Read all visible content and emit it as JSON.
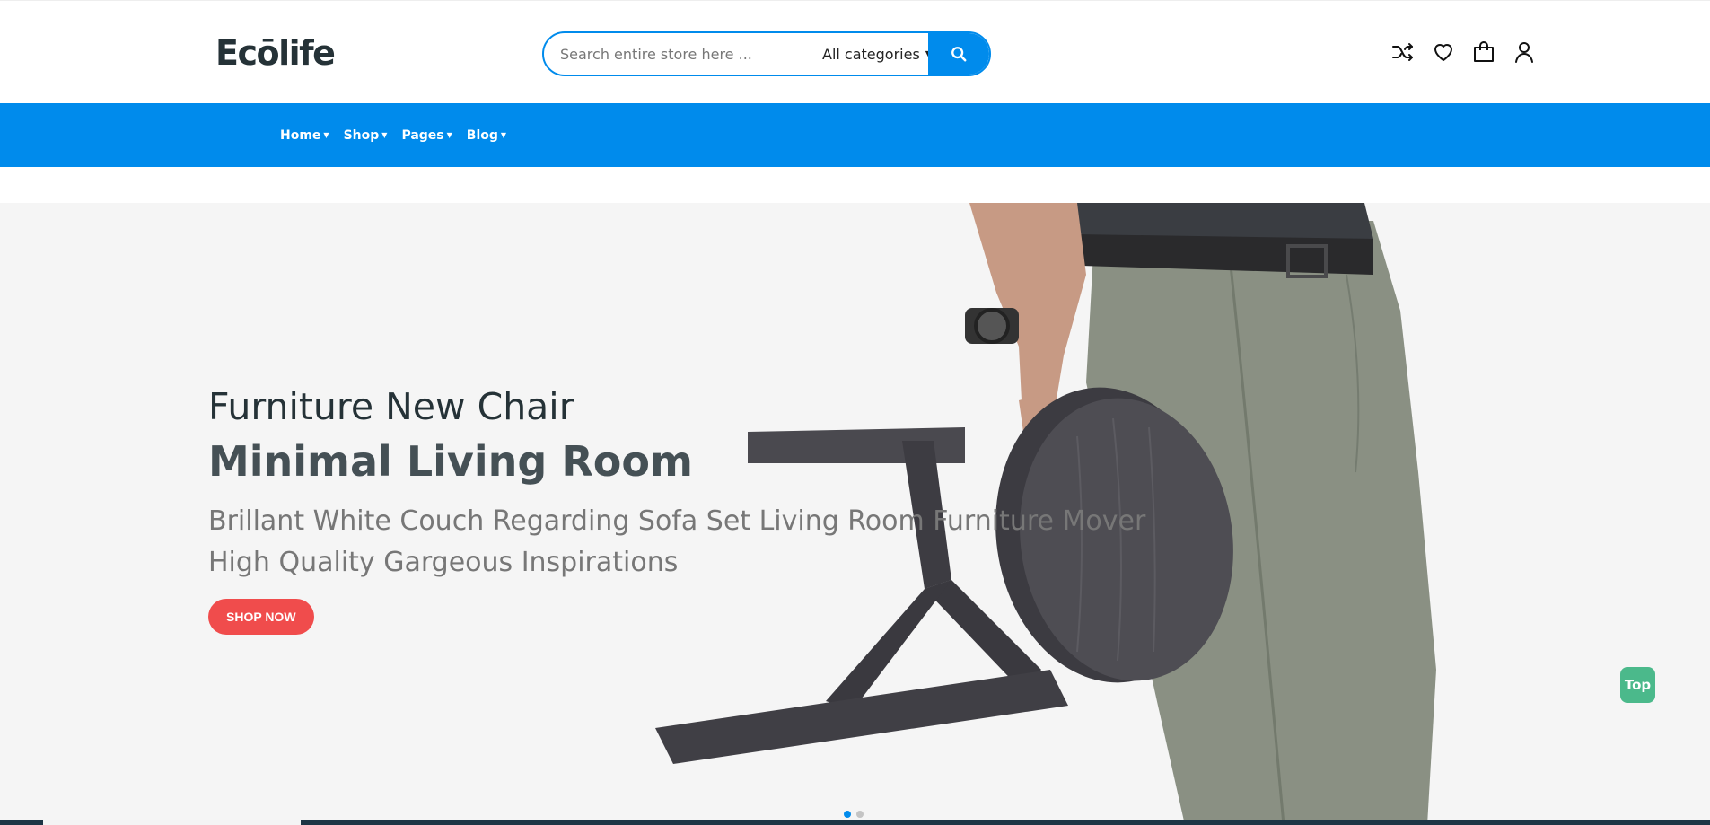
{
  "brand": {
    "logo_text": "Ecōlife"
  },
  "search": {
    "placeholder": "Search entire store here ...",
    "category": "All categories",
    "icon": "search-icon"
  },
  "header_icons": [
    "shuffle-icon",
    "heart-icon",
    "bag-icon",
    "user-icon"
  ],
  "nav": {
    "items": [
      {
        "label": "Home"
      },
      {
        "label": "Shop"
      },
      {
        "label": "Pages"
      },
      {
        "label": "Blog"
      }
    ]
  },
  "hero": {
    "subtitle": "Furniture New Chair",
    "title": "Minimal Living Room",
    "description": "Brillant White Couch Regarding Sofa Set Living Room Furniture Mover High Quality Gargeous Inspirations",
    "button_label": "SHOP NOW",
    "slides_count": 2,
    "active_slide": 1
  },
  "back_to_top": {
    "label": "Top"
  },
  "colors": {
    "primary": "#008bec",
    "accent_red": "#f04c4c",
    "top_green": "#4bb98b",
    "text_dark": "#253237",
    "hero_bg": "#f5f5f5"
  }
}
